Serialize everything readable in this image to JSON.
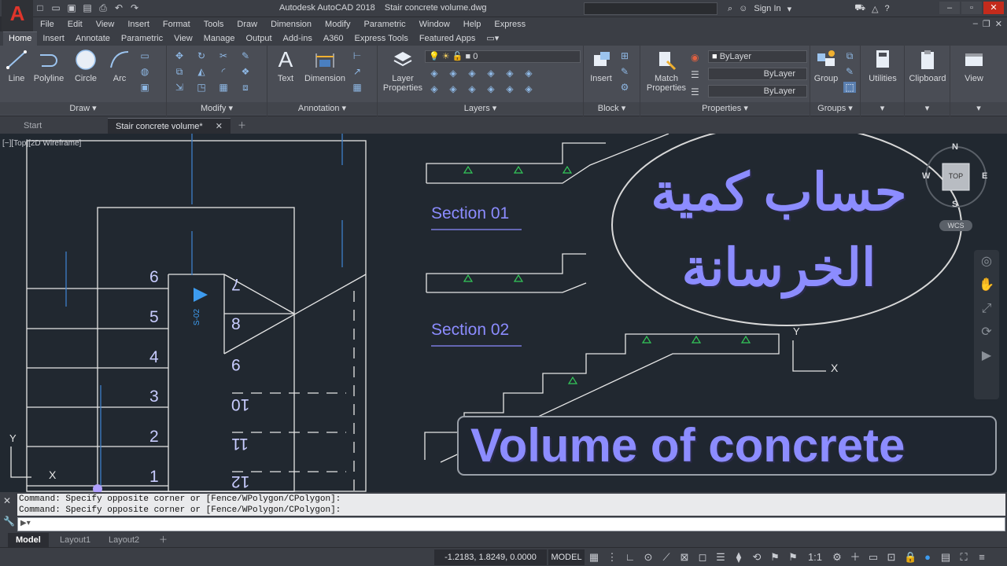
{
  "app": {
    "logo": "A",
    "title": "Autodesk AutoCAD 2018    Stair concrete volume.dwg",
    "sign_in": "Sign In"
  },
  "menu": [
    "File",
    "Edit",
    "View",
    "Insert",
    "Format",
    "Tools",
    "Draw",
    "Dimension",
    "Modify",
    "Parametric",
    "Window",
    "Help",
    "Express"
  ],
  "ribbon_tabs": [
    "Home",
    "Insert",
    "Annotate",
    "Parametric",
    "View",
    "Manage",
    "Output",
    "Add-ins",
    "A360",
    "Express Tools",
    "Featured Apps"
  ],
  "ribbon": {
    "draw": {
      "title": "Draw ▾",
      "line": "Line",
      "polyline": "Polyline",
      "circle": "Circle",
      "arc": "Arc"
    },
    "modify": {
      "title": "Modify ▾"
    },
    "annotation": {
      "title": "Annotation ▾",
      "text": "Text",
      "dimension": "Dimension"
    },
    "layers": {
      "title": "Layers ▾",
      "layer_properties_1": "Layer",
      "layer_properties_2": "Properties",
      "current_layer": "0"
    },
    "block": {
      "title": "Block ▾",
      "insert": "Insert"
    },
    "properties": {
      "title": "Properties ▾",
      "match_1": "Match",
      "match_2": "Properties",
      "color": "ByLayer",
      "linetype": "ByLayer",
      "lineweight": "ByLayer"
    },
    "groups": {
      "title": "Groups ▾",
      "group": "Group"
    },
    "utilities": "Utilities",
    "clipboard": "Clipboard",
    "view": "View"
  },
  "file_tabs": {
    "start": "Start",
    "active": "Stair concrete volume*"
  },
  "viewport_label": "[−][Top][2D Wireframe]",
  "drawing": {
    "step_numbers": [
      "6",
      "5",
      "4",
      "3",
      "2",
      "1"
    ],
    "upper_numbers": [
      "7",
      "8",
      "9",
      "10",
      "11",
      "12"
    ],
    "section_marker": "S-02",
    "section_1": "Section 01",
    "section_2": "Section 02",
    "arabic_line1": "حساب كمية",
    "arabic_line2": "الخرسانة",
    "banner": "Volume of concrete",
    "ucs_y": "Y",
    "ucs_x": "X"
  },
  "viewcube": {
    "n": "N",
    "s": "S",
    "w": "W",
    "e": "E",
    "top": "TOP",
    "wcs": "WCS"
  },
  "command": {
    "line1": "Command: Specify opposite corner or [Fence/WPolygon/CPolygon]:",
    "line2": "Command: Specify opposite corner or [Fence/WPolygon/CPolygon]:"
  },
  "layout_tabs": [
    "Model",
    "Layout1",
    "Layout2"
  ],
  "status": {
    "coords": "-1.2183, 1.8249, 0.0000",
    "model": "MODEL",
    "scale": "1:1"
  },
  "colors": {
    "canvas": "#212830",
    "ribbon": "#4a4d55",
    "accent_text": "#8c8cff",
    "cad_lines": "#e6e6e6"
  }
}
